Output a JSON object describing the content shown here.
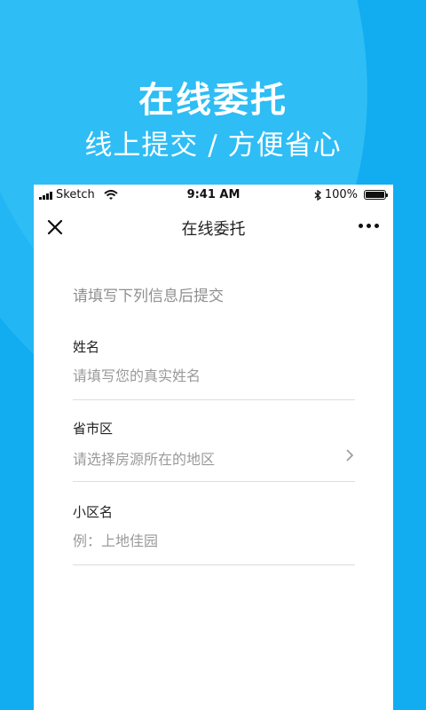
{
  "hero": {
    "title": "在线委托",
    "subtitle": "线上提交 / 方便省心"
  },
  "status_bar": {
    "carrier": "Sketch",
    "time": "9:41 AM",
    "battery": "100%",
    "icons": [
      "signal-icon",
      "wifi-icon",
      "bluetooth-icon",
      "battery-icon"
    ]
  },
  "navbar": {
    "title": "在线委托",
    "left_icon": "close-icon",
    "right_icon": "more-icon"
  },
  "form": {
    "intro": "请填写下列信息后提交",
    "name": {
      "label": "姓名",
      "placeholder": "请填写您的真实姓名",
      "value": ""
    },
    "region": {
      "label": "省市区",
      "placeholder": "请选择房源所在的地区"
    },
    "community": {
      "label": "小区名",
      "placeholder": "例：上地佳园",
      "value": ""
    }
  },
  "colors": {
    "background": "#12acf0",
    "card": "#ffffff",
    "placeholder": "#9a9a9a",
    "divider": "#dddddd"
  }
}
